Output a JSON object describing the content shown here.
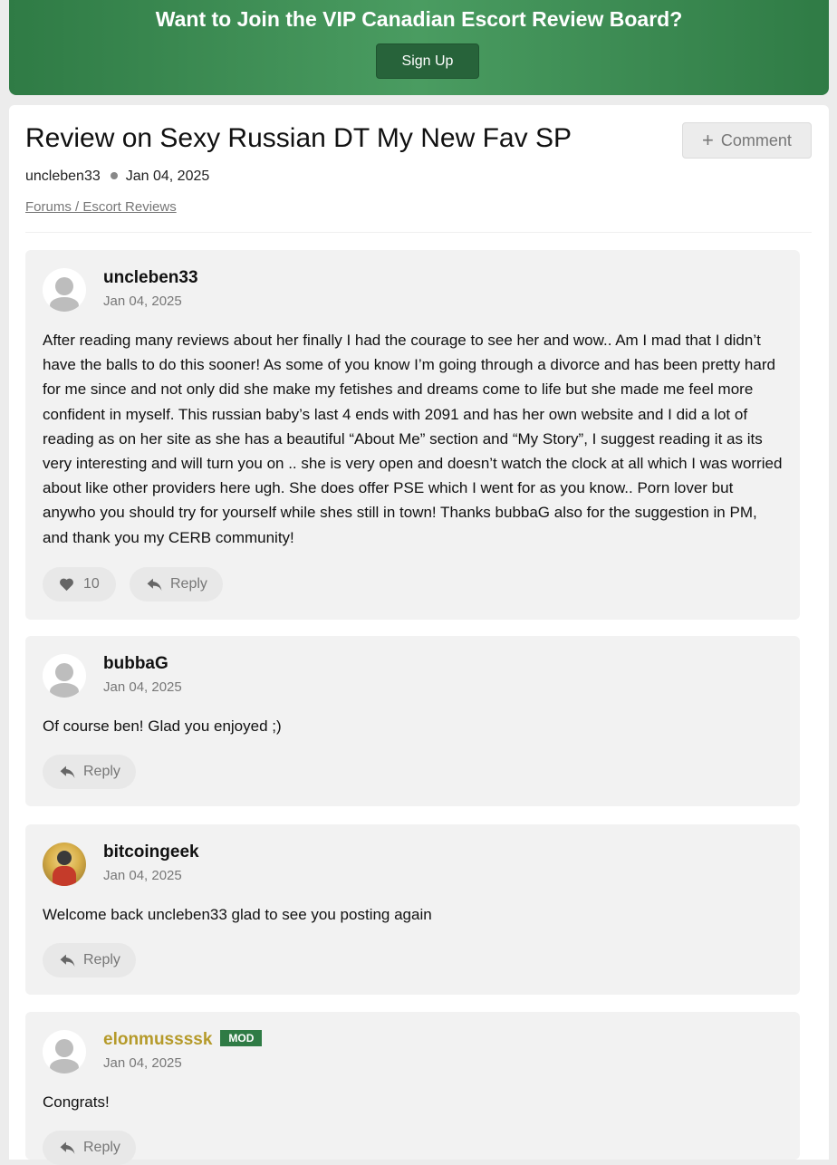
{
  "banner": {
    "title": "Want to Join the VIP Canadian Escort Review Board?",
    "signup_label": "Sign Up"
  },
  "post": {
    "title": "Review on Sexy Russian DT My New Fav SP",
    "author": "uncleben33",
    "date": "Jan 04, 2025",
    "breadcrumb": "Forums / Escort Reviews",
    "comment_label": "Comment"
  },
  "replies": [
    {
      "username": "uncleben33",
      "date": "Jan 04, 2025",
      "avatar": "default-avatar-icon",
      "text": "After reading many reviews about her finally I had the courage to see her and wow.. Am I mad that I didn’t have the balls to do this sooner! As some of you know I’m going through a divorce and has been pretty hard for me since and not only did she make my fetishes and dreams come to life but she made me feel more confident in myself. This russian baby’s last 4 ends with 2091 and has her own website and I did a lot of reading as on her site as she has a beautiful “About Me” section and “My Story”, I suggest reading it as its very interesting and will turn you on .. she is very open and doesn’t watch the clock at all which I was worried about like other providers here ugh. She does offer PSE which I went for as you know.. Porn lover but anywho you should try for yourself while shes still in town! Thanks bubbaG also for the suggestion in PM, and thank you my CERB community!",
      "likes": "10",
      "reply_label": "Reply"
    },
    {
      "username": "bubbaG",
      "date": "Jan 04, 2025",
      "avatar": "default-avatar-icon",
      "text": "Of course ben! Glad you enjoyed ;)",
      "reply_label": "Reply"
    },
    {
      "username": "bitcoingeek",
      "date": "Jan 04, 2025",
      "avatar": "photo-avatar-icon",
      "text": "Welcome back uncleben33 glad to see you posting again",
      "reply_label": "Reply"
    },
    {
      "username": "elonmussssk",
      "badge": "MOD",
      "date": "Jan 04, 2025",
      "avatar": "default-avatar-icon",
      "text": "Congrats!",
      "reply_label": "Reply"
    }
  ],
  "colors": {
    "banner_green": "#4a9c61",
    "signup_button": "#27633a",
    "mod_name": "#b59a2a",
    "mod_badge": "#2f7b45"
  }
}
